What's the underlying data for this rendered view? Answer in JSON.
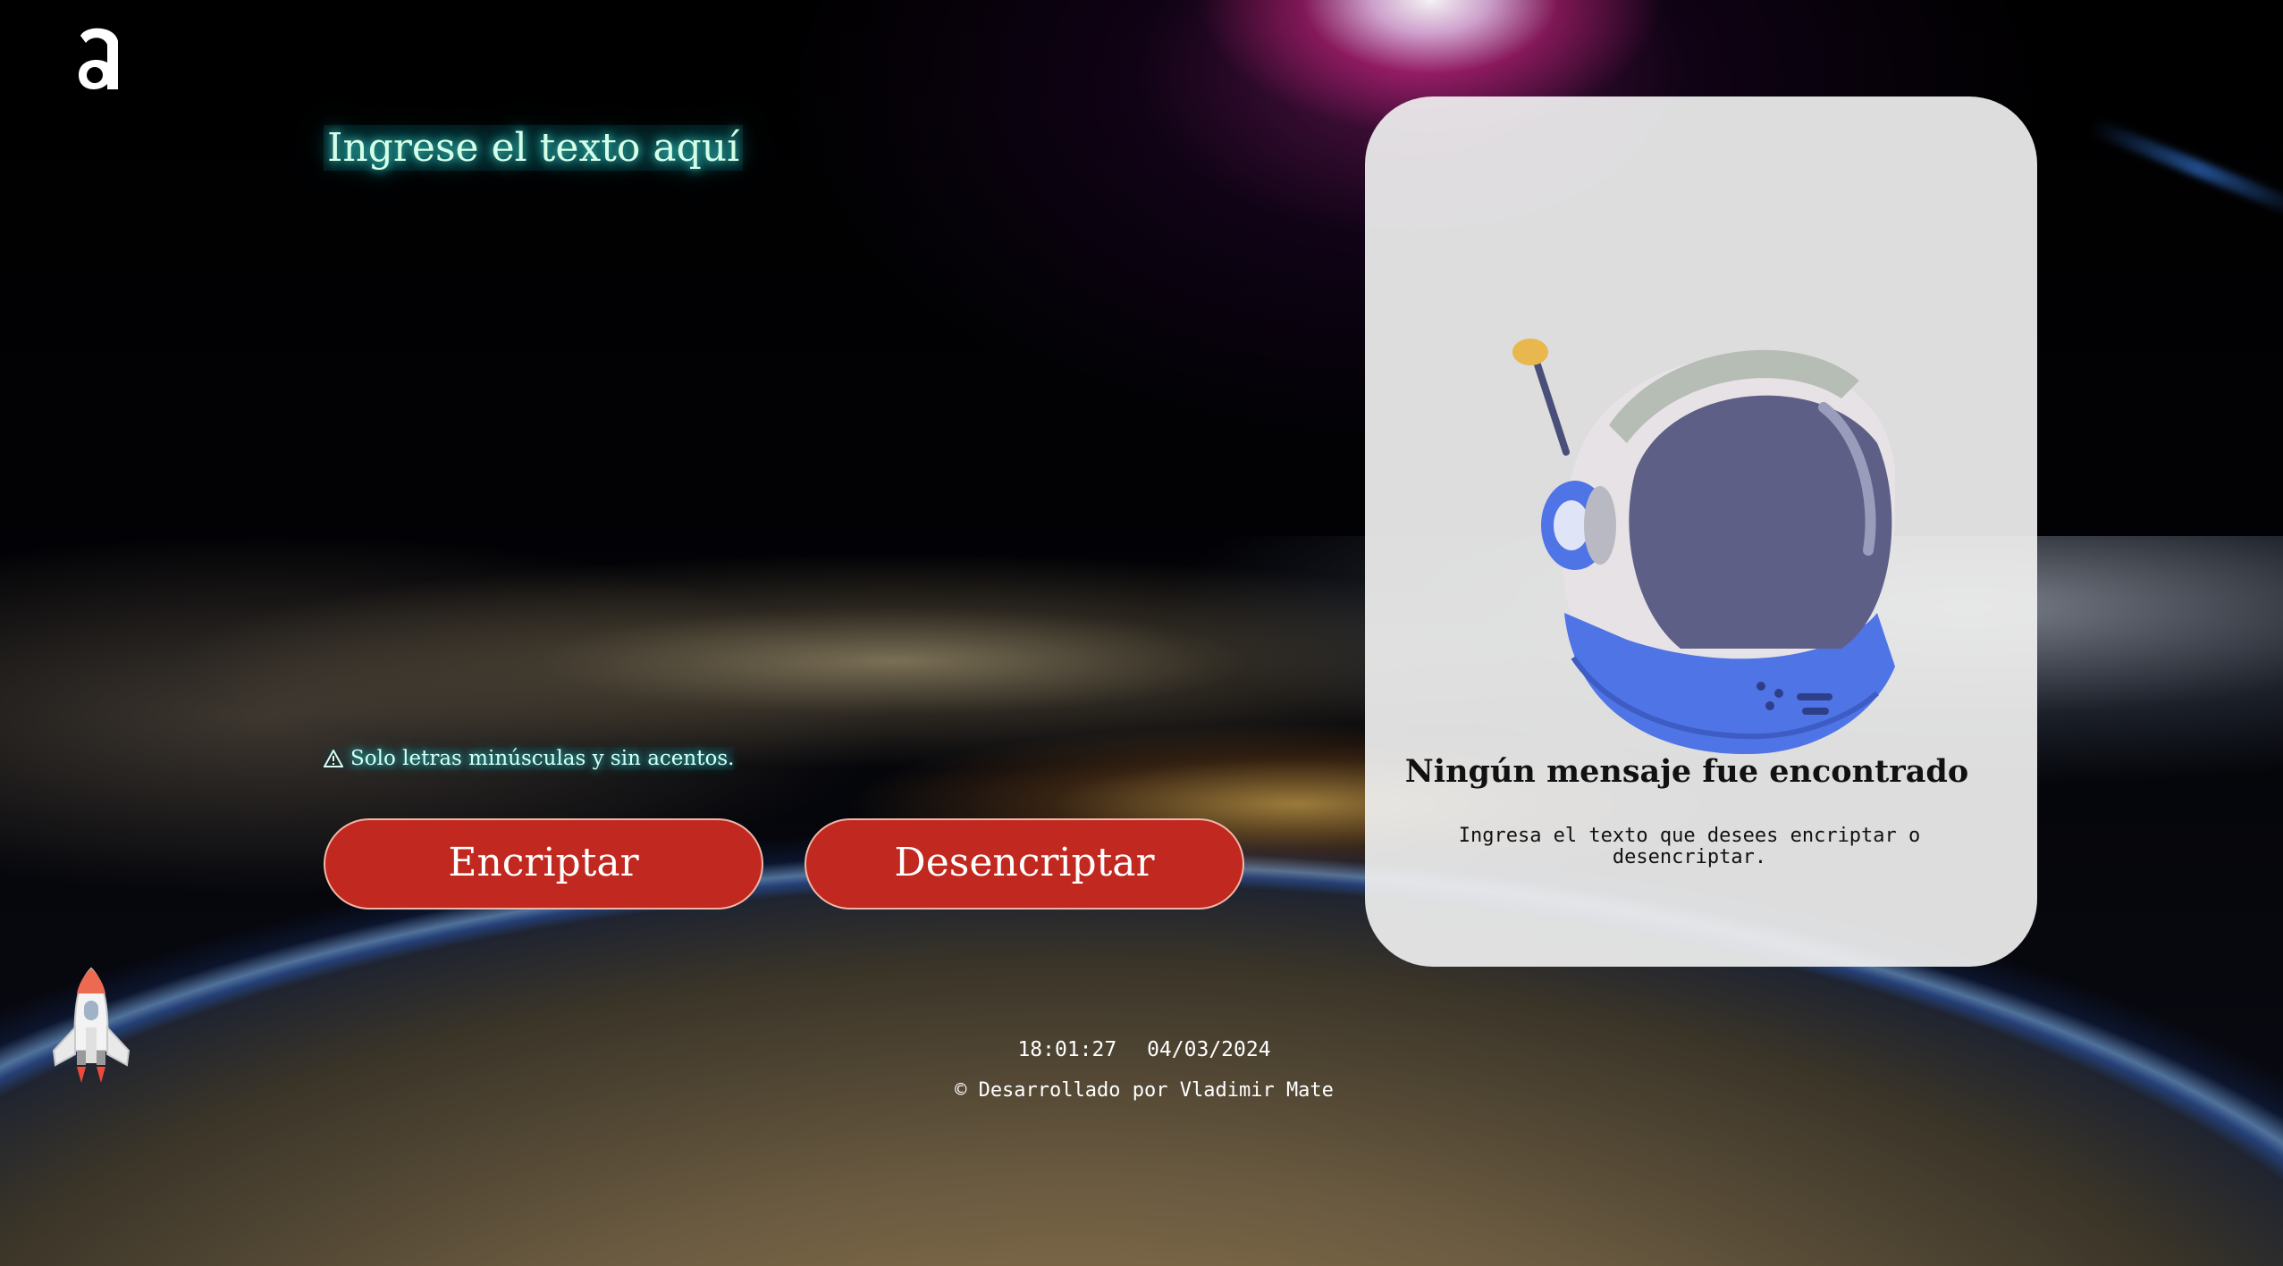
{
  "input": {
    "placeholder": "Ingrese el texto aquí",
    "value": ""
  },
  "warning": {
    "icon": "warning-icon",
    "text": "Solo letras minúsculas y sin acentos."
  },
  "buttons": {
    "encrypt_label": "Encriptar",
    "decrypt_label": "Desencriptar"
  },
  "output_panel": {
    "title": "Ningún mensaje fue encontrado",
    "subtitle": "Ingresa el texto que desees encriptar o desencriptar."
  },
  "clock": {
    "time": "18:01:27",
    "date": "04/03/2024"
  },
  "footer": {
    "text": "© Desarrollado por Vladimir Mate"
  },
  "colors": {
    "button_red": "#c1281f",
    "glow_cyan": "#3fd8d0",
    "panel_bg": "#f0f0f0",
    "helmet_blue": "#4f74e6"
  }
}
